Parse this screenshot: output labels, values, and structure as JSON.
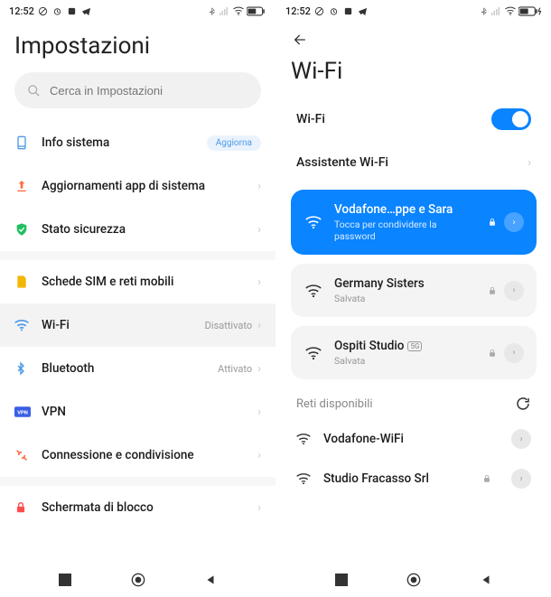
{
  "status": {
    "time": "12:52",
    "icons_left": [
      "no-disturb-icon",
      "alarm-icon",
      "app-icon",
      "telegram-icon"
    ],
    "icons_right": [
      "bluetooth-icon",
      "signal-icon",
      "wifi-icon",
      "battery-icon"
    ]
  },
  "left": {
    "title": "Impostazioni",
    "search_placeholder": "Cerca in Impostazioni",
    "items": [
      {
        "name": "info-sistema",
        "label": "Info sistema",
        "color": "#4d9ae6",
        "badge": "Aggiorna"
      },
      {
        "name": "aggiornamenti",
        "label": "Aggiornamenti app di sistema",
        "color": "#ff6a3d"
      },
      {
        "name": "stato-sicurezza",
        "label": "Stato sicurezza",
        "color": "#1fbf62"
      }
    ],
    "items2": [
      {
        "name": "sim",
        "label": "Schede SIM e reti mobili",
        "color": "#f2b705"
      },
      {
        "name": "wifi",
        "label": "Wi-Fi",
        "color": "#4d9ae6",
        "status": "Disattivato",
        "selected": true
      },
      {
        "name": "bluetooth",
        "label": "Bluetooth",
        "color": "#4d9ae6",
        "status": "Attivato"
      },
      {
        "name": "vpn",
        "label": "VPN",
        "color": "#3a5ee6"
      },
      {
        "name": "connessione",
        "label": "Connessione e condivisione",
        "color": "#ff6a3d"
      }
    ],
    "items3": [
      {
        "name": "blocco",
        "label": "Schermata di blocco",
        "color": "#ff4d4d"
      }
    ]
  },
  "right": {
    "title": "Wi-Fi",
    "toggle_label": "Wi-Fi",
    "assistant_label": "Assistente Wi-Fi",
    "networks": {
      "connected": {
        "name": "Vodafone…ppe e Sara",
        "sub": "Tocca per condividere la password",
        "locked": true
      },
      "saved": [
        {
          "name": "Germany Sisters",
          "sub": "Salvata",
          "locked": true
        },
        {
          "name": "Ospiti Studio",
          "sub": "Salvata",
          "badge": "5G",
          "locked": true
        }
      ],
      "available_label": "Reti disponibili",
      "available": [
        {
          "name": "Vodafone-WiFi",
          "locked": false
        },
        {
          "name": "Studio Fracasso Srl",
          "locked": true
        }
      ]
    }
  },
  "nav": {
    "recent": "■",
    "home": "◉",
    "back": "◀"
  }
}
